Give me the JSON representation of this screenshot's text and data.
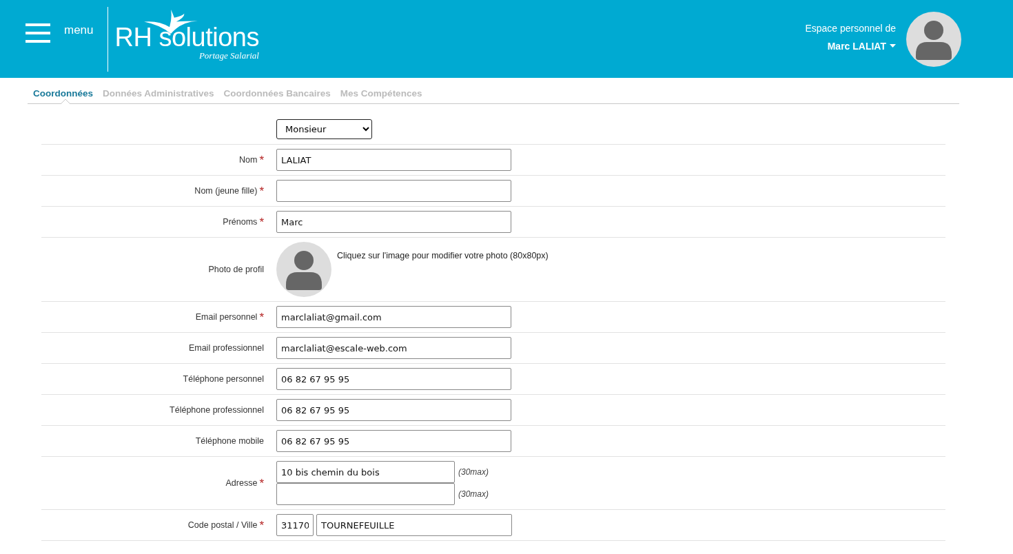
{
  "header": {
    "menu_label": "menu",
    "logo": {
      "name": "RH solutions",
      "tagline": "Portage Salarial"
    },
    "greeting": "Espace personnel de",
    "user_name": "Marc LALIAT"
  },
  "tabs": [
    {
      "label": "Coordonnées",
      "selected": true
    },
    {
      "label": "Données Administratives",
      "selected": false
    },
    {
      "label": "Coordonnées Bancaires",
      "selected": false
    },
    {
      "label": "Mes Compétences",
      "selected": false
    }
  ],
  "required_mark": "*",
  "form": [
    {
      "kind": "select",
      "value": "Monsieur",
      "required": false
    },
    {
      "kind": "text",
      "label": "Nom",
      "value": "LALIAT",
      "required": true
    },
    {
      "kind": "text",
      "label": "Nom (jeune fille)",
      "required": true
    },
    {
      "kind": "text",
      "label": "Prénoms",
      "value": "Marc",
      "required": true
    },
    {
      "kind": "photo",
      "label": "Photo de profil",
      "hint": "Cliquez sur l'image pour modifier votre photo (80x80px)",
      "required": false
    },
    {
      "kind": "text",
      "label": "Email personnel",
      "value": "marclaliat@gmail.com",
      "required": true
    },
    {
      "kind": "text",
      "label": "Email professionnel",
      "value": "marclaliat@escale-web.com",
      "required": false
    },
    {
      "kind": "text",
      "label": "Téléphone personnel",
      "value": "06 82 67 95 95",
      "required": false
    },
    {
      "kind": "text",
      "label": "Téléphone professionnel",
      "value": "06 82 67 95 95",
      "required": false
    },
    {
      "kind": "text",
      "label": "Téléphone mobile",
      "value": "06 82 67 95 95",
      "required": false
    },
    {
      "kind": "address",
      "label": "Adresse",
      "lines": [
        {
          "value": "10 bis chemin du bois",
          "note": "(30max)"
        },
        {
          "note": "(30max)"
        }
      ],
      "required": true
    },
    {
      "kind": "postal",
      "label": "Code postal / Ville",
      "postcode": "31170",
      "city": "TOURNEFEUILLE",
      "required": true
    }
  ]
}
